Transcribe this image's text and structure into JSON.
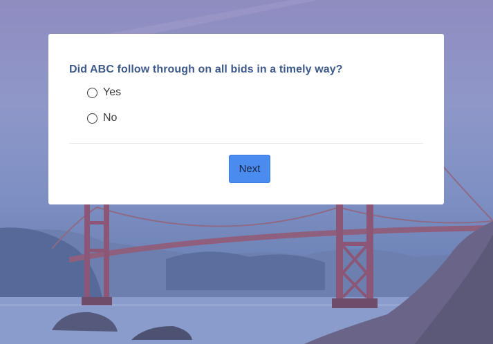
{
  "survey": {
    "question": "Did ABC follow through on all bids in a timely way?",
    "options": [
      {
        "label": "Yes",
        "selected": false
      },
      {
        "label": "No",
        "selected": false
      }
    ],
    "next_label": "Next"
  },
  "colors": {
    "question_text": "#3d5a8a",
    "button": "#4a8bf0",
    "card": "#ffffff"
  }
}
